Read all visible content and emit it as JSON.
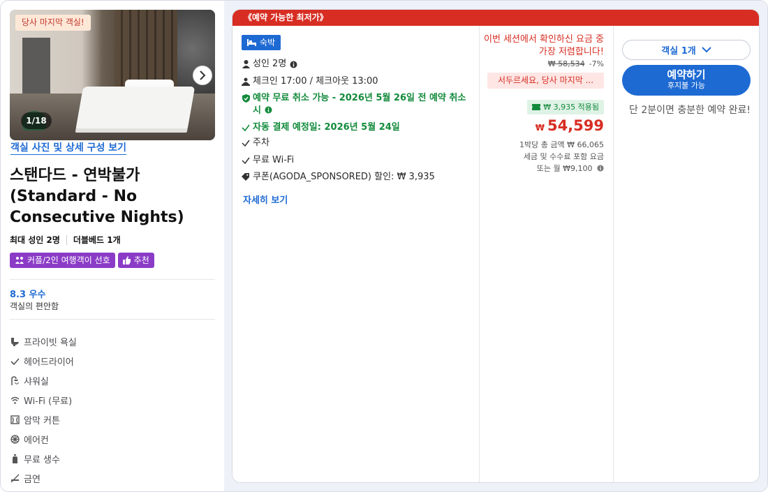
{
  "room": {
    "photo_badge": "당사 마지막 객실!",
    "photo_counter": "1/18",
    "photo_link": "객실 사진 및 상세 구성 보기",
    "title": "스탠다드 - 연박불가 (Standard - No Consecutive Nights)",
    "max_guests": "최대 성인 2명",
    "bed": "더블베드 1개",
    "tags": [
      "커플/2인 여행객이 선호",
      "추천"
    ],
    "score": "8.3 우수",
    "score_sub": "객실의 편안함",
    "amenities": [
      {
        "icon": "toilet-icon",
        "label": "프라이빗 욕실"
      },
      {
        "icon": "check-icon",
        "label": "헤어드라이어"
      },
      {
        "icon": "shower-icon",
        "label": "샤워실"
      },
      {
        "icon": "wifi-icon",
        "label": "Wi-Fi (무료)"
      },
      {
        "icon": "blackout-curtain-icon",
        "label": "암막 커튼"
      },
      {
        "icon": "fan-icon",
        "label": "에어컨"
      },
      {
        "icon": "water-bottle-icon",
        "label": "무료 생수"
      },
      {
        "icon": "no-smoking-icon",
        "label": "금연"
      }
    ]
  },
  "offer": {
    "header": "《예약 가능한 최저가》",
    "stay_badge": "숙박",
    "guests": "성인 2명",
    "checkin": "체크인 17:00 / 체크아웃 13:00",
    "free_cancel": "예약 무료 취소 가능 - 2026년 5월 26일 전 예약 취소 시",
    "auto_pay": "자동 결제 예정일: 2026년 5월 24일",
    "parking": "주차",
    "wifi": "무료 Wi-Fi",
    "coupon_line": "쿠폰(AGODA_SPONSORED) 할인: ₩ 3,935",
    "more_link": "자세히 보기"
  },
  "price": {
    "lowest_msg": "이번 세션에서 확인하신 요금 중 가장 저렴합니다!",
    "original": "₩ 58,534",
    "discount": "-7%",
    "hurry": "서두르세요, 당사 마지막 ...",
    "coupon_applied": "₩ 3,935 적용됨",
    "currency": "₩",
    "final": "54,599",
    "per_night_total": "1박당 총 금액 ₩ 66,065",
    "tax_note": "세금 및 수수료 포함 요금",
    "monthly": "또는 월 ₩9,100"
  },
  "booking": {
    "room_count": "객실 1개",
    "book_label": "예약하기",
    "book_sub": "후지불 가능",
    "quick_note": "단 2분이면 충분한 예약 완료!"
  },
  "colors": {
    "accent_blue": "#1e6ad3",
    "price_red": "#d72d22",
    "green": "#128a3b",
    "tag_purple": "#8b3cc7"
  }
}
